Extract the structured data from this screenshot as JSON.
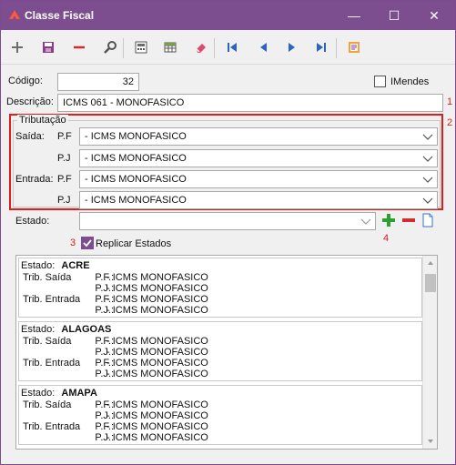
{
  "window": {
    "title": "Classe Fiscal",
    "minimize_glyph": "—",
    "maximize_glyph": "☐",
    "close_glyph": "✕"
  },
  "toolbar": {
    "items": [
      {
        "name": "add-icon"
      },
      {
        "name": "save-icon"
      },
      {
        "name": "remove-icon"
      },
      {
        "name": "search-icon"
      },
      {
        "name": "calculator-icon"
      },
      {
        "name": "table-icon"
      },
      {
        "name": "eraser-icon"
      },
      {
        "name": "first-record-icon"
      },
      {
        "name": "previous-record-icon"
      },
      {
        "name": "next-record-icon"
      },
      {
        "name": "last-record-icon"
      },
      {
        "name": "report-icon"
      }
    ]
  },
  "form": {
    "codigo_label": "Código:",
    "codigo_value": "32",
    "imendes_label": "IMendes",
    "descricao_label": "Descrição:",
    "descricao_value": "ICMS 061 - MONOFASICO",
    "tributacao_legend": "Tributação",
    "saida_label": "Saída:",
    "entrada_label": "Entrada:",
    "pf_label": "P.F",
    "pj_label": "P.J",
    "saida_pf_value": "- ICMS MONOFASICO",
    "saida_pj_value": "- ICMS MONOFASICO",
    "entrada_pf_value": "- ICMS MONOFASICO",
    "entrada_pj_value": "- ICMS MONOFASICO",
    "estado_label": "Estado:",
    "estado_value": "",
    "replicar_label": "Replicar Estados",
    "replicar_checked": true,
    "markers": [
      "1",
      "2",
      "3",
      "4"
    ]
  },
  "list": {
    "estado_prefix": "Estado:",
    "saida_label": "Trib. Saída",
    "entrada_label": "Trib. Entrada",
    "pf_label": "P.F.:",
    "pj_label": "P.J.:",
    "states": [
      {
        "name": "ACRE",
        "saida_pf": "- ICMS MONOFASICO",
        "saida_pj": "- ICMS MONOFASICO",
        "entrada_pf": "- ICMS MONOFASICO",
        "entrada_pj": "- ICMS MONOFASICO"
      },
      {
        "name": "ALAGOAS",
        "saida_pf": "- ICMS MONOFASICO",
        "saida_pj": "- ICMS MONOFASICO",
        "entrada_pf": "- ICMS MONOFASICO",
        "entrada_pj": "- ICMS MONOFASICO"
      },
      {
        "name": "AMAPA",
        "saida_pf": "- ICMS MONOFASICO",
        "saida_pj": "- ICMS MONOFASICO",
        "entrada_pf": "- ICMS MONOFASICO",
        "entrada_pj": "- ICMS MONOFASICO"
      }
    ]
  },
  "colors": {
    "titlebar": "#7c4d8f",
    "highlight_red": "#e21c1c",
    "checkbox_fill": "#7c4d8f",
    "add_green": "#2e9e2e",
    "remove_red": "#d12c2c"
  }
}
